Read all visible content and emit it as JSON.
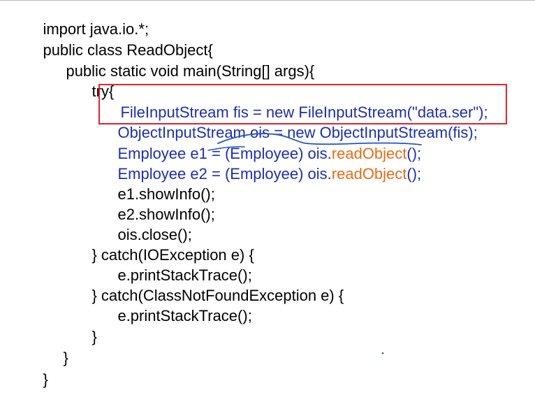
{
  "code_lines": [
    {
      "segments": [
        "import java.io.*;"
      ]
    },
    {
      "segments": [
        "public class ReadObject{"
      ]
    },
    {
      "segments": [
        "public static void main(String[] args){"
      ]
    },
    {
      "segments": [
        "try{"
      ]
    },
    {
      "segments": [
        "FileInputStream fis = new FileInputStream(\"data.ser\");"
      ]
    },
    {
      "segments": [
        "ObjectInputStream ois = new ObjectInputStream(fis);"
      ]
    },
    {
      "segments": [
        "Employee e1 = (Employee) ois.",
        "readObject",
        "();"
      ]
    },
    {
      "segments": [
        "Employee e2 = (Employee) ois.",
        "readObject",
        "();"
      ]
    },
    {
      "segments": [
        "e1.showInfo();"
      ]
    },
    {
      "segments": [
        "e2.showInfo();"
      ]
    },
    {
      "segments": [
        "ois.close();"
      ]
    },
    {
      "segments": [
        "} catch(IOException e) {"
      ]
    },
    {
      "segments": [
        "e.printStackTrace();"
      ]
    },
    {
      "segments": [
        "} catch(ClassNotFoundException e) {"
      ]
    },
    {
      "segments": [
        "e.printStackTrace();"
      ]
    },
    {
      "segments": [
        "}"
      ]
    },
    {
      "segments": [
        "}"
      ]
    },
    {
      "segments": [
        "}"
      ]
    }
  ],
  "colors": {
    "default_text": "#000000",
    "highlight_blue": "#1c2fb0",
    "method_orange": "#e86c16",
    "box_red": "#e0242c",
    "annotation_blue": "#1f55c4"
  }
}
